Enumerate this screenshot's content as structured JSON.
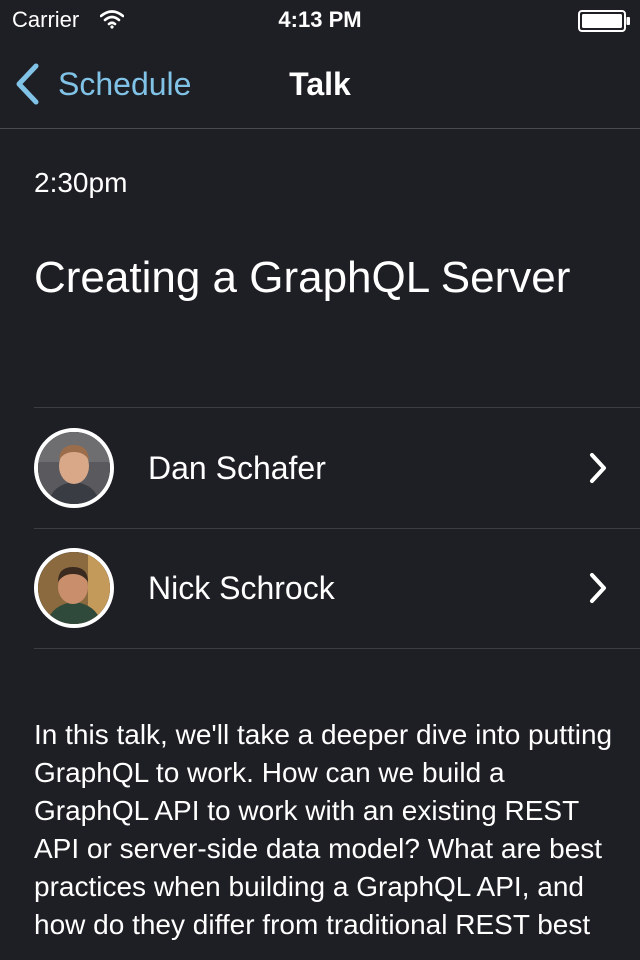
{
  "status_bar": {
    "carrier": "Carrier",
    "time": "4:13 PM"
  },
  "nav": {
    "back_label": "Schedule",
    "title": "Talk"
  },
  "talk": {
    "time": "2:30pm",
    "title": "Creating a GraphQL Server",
    "speakers": [
      {
        "name": "Dan Schafer"
      },
      {
        "name": "Nick Schrock"
      }
    ],
    "description": "In this talk, we'll take a deeper dive into putting GraphQL to work. How can we build a GraphQL API to work with an existing REST API or server-side data model? What are best practices when building a GraphQL API, and how do they differ from traditional REST best"
  },
  "colors": {
    "background": "#1e1f24",
    "accent": "#81c3e7",
    "text": "#ffffff"
  }
}
